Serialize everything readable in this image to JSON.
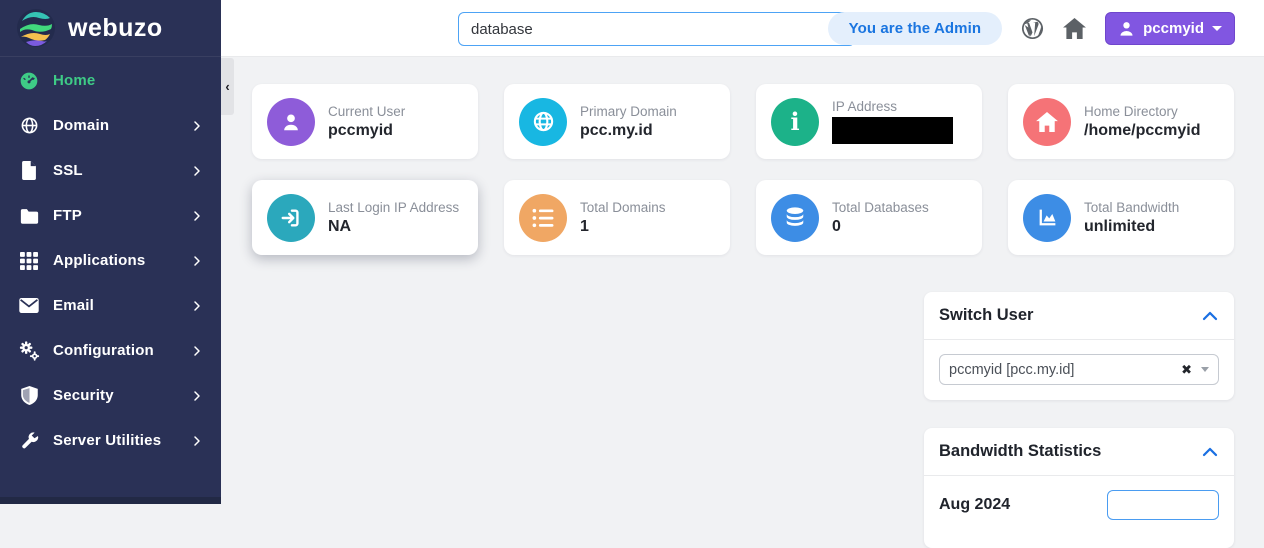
{
  "brand": {
    "name": "webuzo"
  },
  "sidebar": {
    "items": [
      {
        "label": "Home",
        "icon": "gauge-icon",
        "active": true,
        "has_submenu": false
      },
      {
        "label": "Domain",
        "icon": "globe-icon",
        "active": false,
        "has_submenu": true
      },
      {
        "label": "SSL",
        "icon": "file-icon",
        "active": false,
        "has_submenu": true
      },
      {
        "label": "FTP",
        "icon": "folder-icon",
        "active": false,
        "has_submenu": true
      },
      {
        "label": "Applications",
        "icon": "grid-icon",
        "active": false,
        "has_submenu": true
      },
      {
        "label": "Email",
        "icon": "envelope-icon",
        "active": false,
        "has_submenu": true
      },
      {
        "label": "Configuration",
        "icon": "gears-icon",
        "active": false,
        "has_submenu": true
      },
      {
        "label": "Security",
        "icon": "shield-icon",
        "active": false,
        "has_submenu": true
      },
      {
        "label": "Server Utilities",
        "icon": "wrench-icon",
        "active": false,
        "has_submenu": true
      }
    ]
  },
  "header": {
    "search": {
      "value": "database"
    },
    "admin_badge": "You are the Admin",
    "icons": [
      "wordpress-icon",
      "home-icon"
    ],
    "user_menu": {
      "label": "pccmyid"
    }
  },
  "stats_cards": [
    {
      "label": "Current User",
      "value": "pccmyid",
      "icon": "user-icon",
      "color": "#8e5cd9",
      "redacted": false,
      "highlight": false
    },
    {
      "label": "Primary Domain",
      "value": "pcc.my.id",
      "icon": "globe-icon",
      "color": "#18b7e2",
      "redacted": false,
      "highlight": false
    },
    {
      "label": "IP Address",
      "value": "",
      "icon": "info-icon",
      "color": "#1cb289",
      "redacted": true,
      "highlight": false
    },
    {
      "label": "Home Directory",
      "value": "/home/pccmyid",
      "icon": "home-icon",
      "color": "#f57377",
      "redacted": false,
      "highlight": false
    },
    {
      "label": "Last Login IP Address",
      "value": "NA",
      "icon": "signin-icon",
      "color": "#2ba8bc",
      "redacted": false,
      "highlight": true
    },
    {
      "label": "Total Domains",
      "value": "1",
      "icon": "list-icon",
      "color": "#f0a764",
      "redacted": false,
      "highlight": false
    },
    {
      "label": "Total Databases",
      "value": "0",
      "icon": "database-icon",
      "color": "#3d8de5",
      "redacted": false,
      "highlight": false
    },
    {
      "label": "Total Bandwidth",
      "value": "unlimited",
      "icon": "chart-icon",
      "color": "#3d8de5",
      "redacted": false,
      "highlight": false
    }
  ],
  "panels": {
    "switch_user": {
      "title": "Switch User",
      "select_value": "pccmyid [pcc.my.id]"
    },
    "bandwidth": {
      "title": "Bandwidth Statistics",
      "period": "Aug 2024"
    }
  },
  "colors": {
    "sidebar_bg": "#2a3156",
    "active_green": "#3ecb86",
    "accent_blue": "#1a75e0",
    "user_button_purple": "#8156e1",
    "search_border": "#4da3f5"
  }
}
